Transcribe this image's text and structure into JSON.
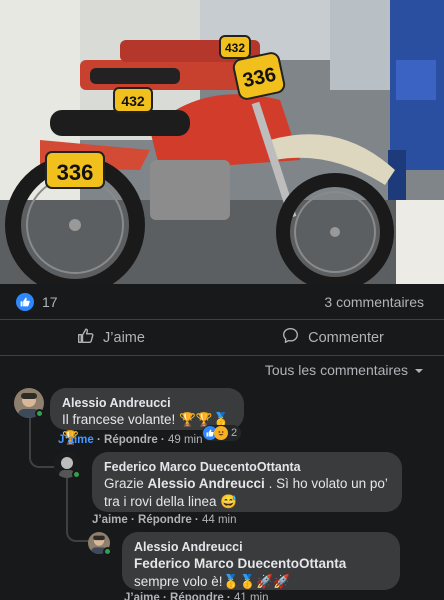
{
  "post": {
    "likes_count": "17",
    "comments_count": "3 commentaires"
  },
  "photo": {
    "number_plates": [
      "336",
      "432",
      "432",
      "336"
    ]
  },
  "actions": {
    "like_label": "J’aime",
    "comment_label": "Commenter"
  },
  "sort": {
    "label": "Tous les commentaires"
  },
  "comments": [
    {
      "author": "Alessio Andreucci",
      "text": "Il francese volante! 🏆🏆🥇🏆",
      "like_label": "J’aime",
      "reply_label": "Répondre",
      "time": "49 min",
      "reaction_count": "2"
    },
    {
      "author": "Federico Marco DuecentoOttanta",
      "mention": "Alessio Andreucci",
      "text_before": "Grazie ",
      "text_after": " . Sì ho volato un po’ tra i rovi della linea 😅",
      "like_label": "J’aime",
      "reply_label": "Répondre",
      "time": "44 min"
    },
    {
      "author": "Alessio Andreucci",
      "mention": "Federico Marco DuecentoOttanta",
      "text_after": " sempre volo è!🥇🥇🚀🚀",
      "like_label": "J’aime",
      "reply_label": "Répondre",
      "time": "41 min"
    }
  ],
  "colors": {
    "background": "#18191a",
    "bubble": "#3a3b3c",
    "link_blue": "#4599ff",
    "like_blue": "#2d88ff",
    "online_green": "#31a24c"
  }
}
